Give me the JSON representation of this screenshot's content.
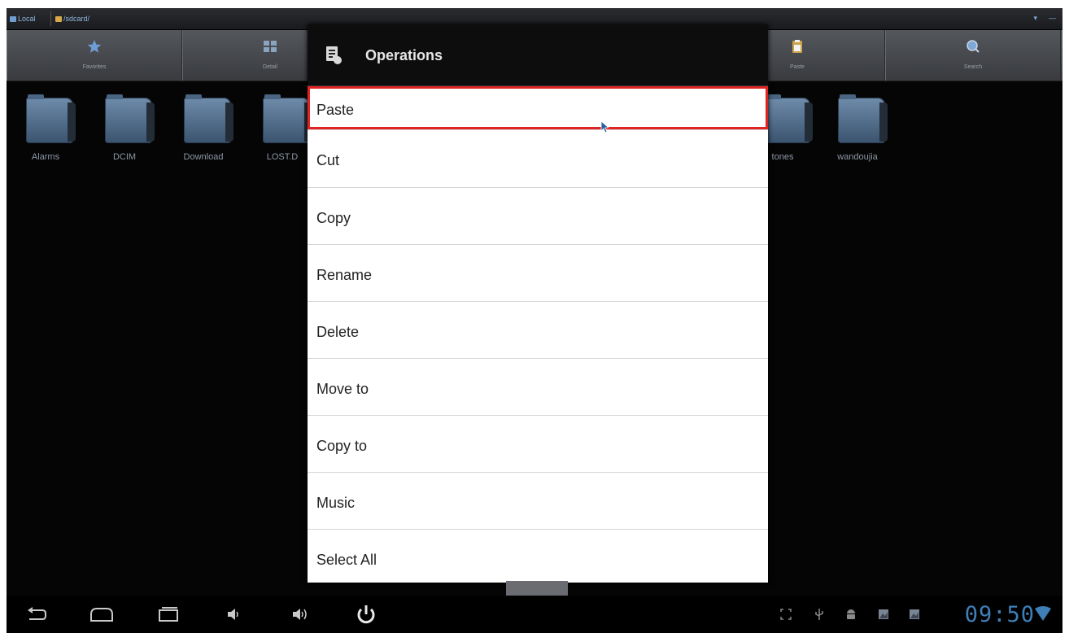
{
  "path_bar": {
    "local_label": "Local",
    "path_label": "/sdcard/"
  },
  "toolbar": {
    "items": [
      {
        "label": "Favorites",
        "icon": "star-icon"
      },
      {
        "label": "Detail",
        "icon": "view-icon"
      },
      {
        "label": "",
        "icon": "hidden-tool-icon"
      },
      {
        "label": "",
        "icon": "hidden-tool-icon"
      },
      {
        "label": "Paste",
        "icon": "clipboard-icon"
      },
      {
        "label": "Search",
        "icon": "search-icon"
      }
    ]
  },
  "files": [
    {
      "name": "Alarms"
    },
    {
      "name": "DCIM"
    },
    {
      "name": "Download"
    },
    {
      "name": "LOST.D"
    },
    {
      "name": "tones"
    },
    {
      "name": "wandoujia"
    }
  ],
  "dialog": {
    "title": "Operations",
    "items": [
      {
        "label": "Paste"
      },
      {
        "label": "Cut"
      },
      {
        "label": "Copy"
      },
      {
        "label": "Rename"
      },
      {
        "label": "Delete"
      },
      {
        "label": "Move to"
      },
      {
        "label": "Copy to"
      },
      {
        "label": "Music"
      },
      {
        "label": "Select All"
      }
    ]
  },
  "status": {
    "clock": "09:50"
  },
  "colors": {
    "highlight": "#e02424",
    "clock": "#3f7fb7"
  }
}
